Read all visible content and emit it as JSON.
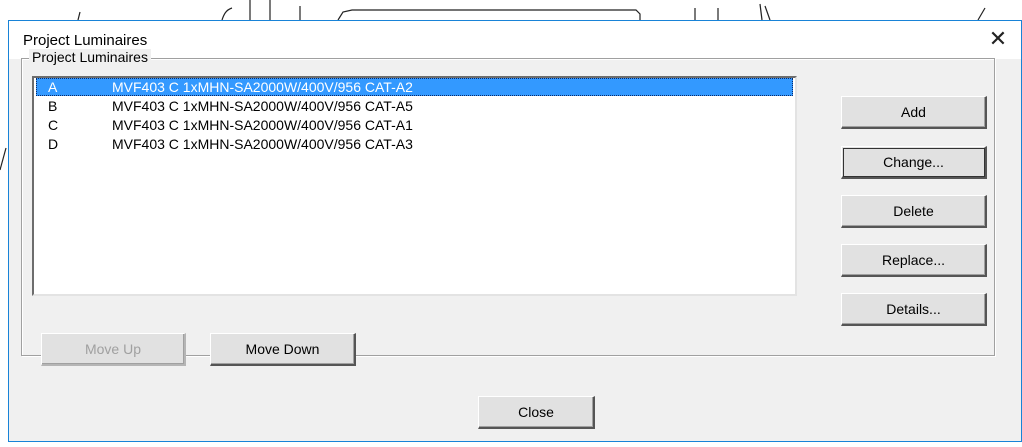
{
  "dialog": {
    "title": "Project Luminaires",
    "close_glyph": "✕",
    "group_label": "Project Luminaires"
  },
  "luminaires": [
    {
      "letter": "A",
      "name": "MVF403 C 1xMHN-SA2000W/400V/956 CAT-A2",
      "selected": true
    },
    {
      "letter": "B",
      "name": "MVF403 C 1xMHN-SA2000W/400V/956 CAT-A5",
      "selected": false
    },
    {
      "letter": "C",
      "name": "MVF403 C 1xMHN-SA2000W/400V/956 CAT-A1",
      "selected": false
    },
    {
      "letter": "D",
      "name": "MVF403 C 1xMHN-SA2000W/400V/956 CAT-A3",
      "selected": false
    }
  ],
  "buttons": {
    "add": "Add",
    "change": "Change...",
    "delete": "Delete",
    "replace": "Replace...",
    "details": "Details...",
    "move_up": "Move Up",
    "move_down": "Move Down",
    "close": "Close"
  },
  "colors": {
    "selection": "#3399ff",
    "window_border": "#1883d7",
    "dialog_bg": "#f0f0f0"
  }
}
